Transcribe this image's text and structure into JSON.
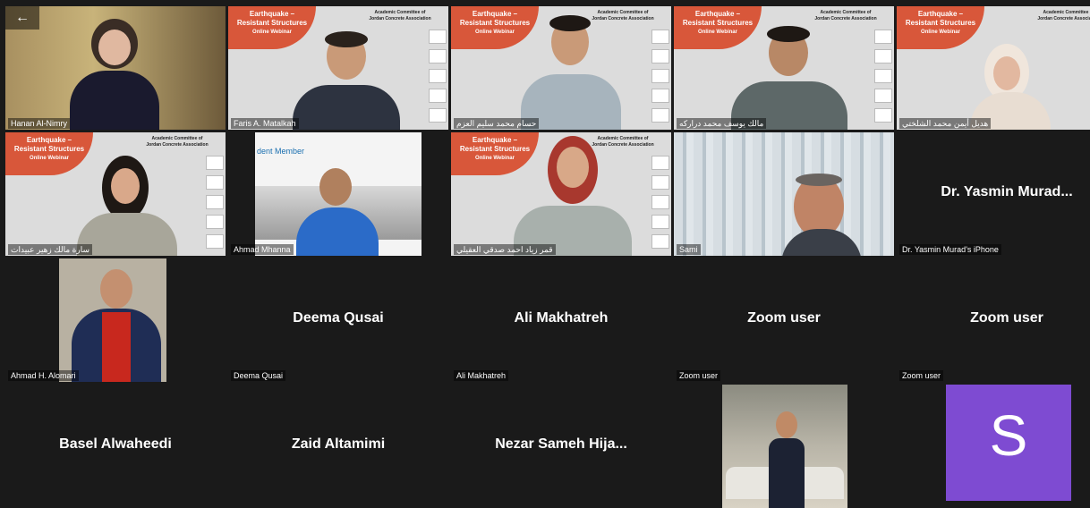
{
  "back_icon": "←",
  "webinar": {
    "title_line1": "Earthquake –",
    "title_line2": "Resistant Structures",
    "subtitle": "Online Webinar",
    "assoc_line1": "Academic Committee of",
    "assoc_line2": "Jordan Concrete Association"
  },
  "participants": [
    {
      "name": "Hanan Al-Nimry",
      "big": ""
    },
    {
      "name": "Faris A. Matalkah",
      "big": ""
    },
    {
      "name": "حسام محمد سليم العزم",
      "big": ""
    },
    {
      "name": "مالك يوسف محمد دراركه",
      "big": ""
    },
    {
      "name": "هديل أيمن محمد الشلختي",
      "big": ""
    },
    {
      "name": "سارة مالك زهير عبيدات",
      "big": ""
    },
    {
      "name": "Ahmad Mhanna",
      "big": "",
      "overlay": "dent Member"
    },
    {
      "name": "قمر زياد احمد صدقي العقيلي",
      "big": ""
    },
    {
      "name": "Sami",
      "big": ""
    },
    {
      "name": "Dr. Yasmin Murad's iPhone",
      "big": "Dr. Yasmin Murad..."
    },
    {
      "name": "Ahmad H. Alomari",
      "big": ""
    },
    {
      "name": "Deema Qusai",
      "big": "Deema Qusai"
    },
    {
      "name": "Ali Makhatreh",
      "big": "Ali Makhatreh"
    },
    {
      "name": "Zoom user",
      "big": "Zoom user"
    },
    {
      "name": "Zoom user",
      "big": "Zoom user"
    },
    {
      "name": "",
      "big": "Basel Alwaheedi"
    },
    {
      "name": "",
      "big": "Zaid Altamimi"
    },
    {
      "name": "",
      "big": "Nezar Sameh Hija..."
    },
    {
      "name": "",
      "big": ""
    },
    {
      "name": "",
      "big": "",
      "avatar_letter": "S"
    }
  ]
}
